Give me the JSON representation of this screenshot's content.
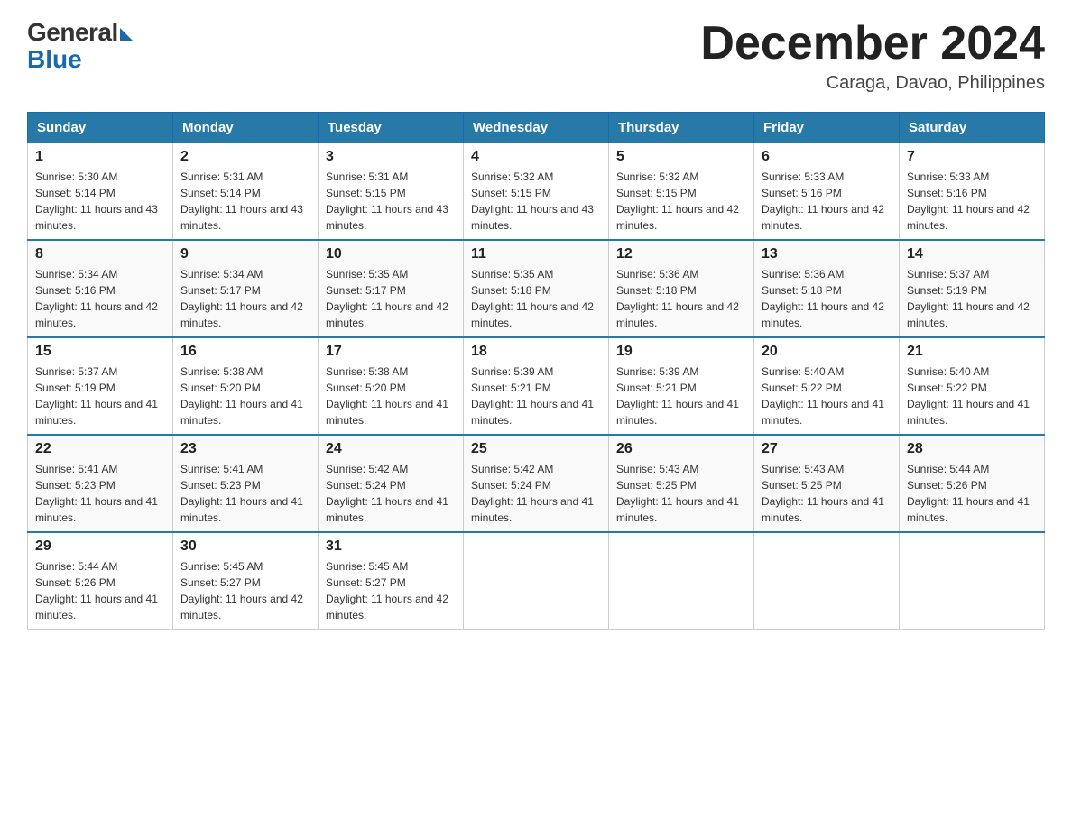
{
  "logo": {
    "general": "General",
    "blue": "Blue"
  },
  "title": {
    "month_year": "December 2024",
    "location": "Caraga, Davao, Philippines"
  },
  "weekdays": [
    "Sunday",
    "Monday",
    "Tuesday",
    "Wednesday",
    "Thursday",
    "Friday",
    "Saturday"
  ],
  "weeks": [
    [
      {
        "day": "1",
        "sunrise": "5:30 AM",
        "sunset": "5:14 PM",
        "daylight": "11 hours and 43 minutes."
      },
      {
        "day": "2",
        "sunrise": "5:31 AM",
        "sunset": "5:14 PM",
        "daylight": "11 hours and 43 minutes."
      },
      {
        "day": "3",
        "sunrise": "5:31 AM",
        "sunset": "5:15 PM",
        "daylight": "11 hours and 43 minutes."
      },
      {
        "day": "4",
        "sunrise": "5:32 AM",
        "sunset": "5:15 PM",
        "daylight": "11 hours and 43 minutes."
      },
      {
        "day": "5",
        "sunrise": "5:32 AM",
        "sunset": "5:15 PM",
        "daylight": "11 hours and 42 minutes."
      },
      {
        "day": "6",
        "sunrise": "5:33 AM",
        "sunset": "5:16 PM",
        "daylight": "11 hours and 42 minutes."
      },
      {
        "day": "7",
        "sunrise": "5:33 AM",
        "sunset": "5:16 PM",
        "daylight": "11 hours and 42 minutes."
      }
    ],
    [
      {
        "day": "8",
        "sunrise": "5:34 AM",
        "sunset": "5:16 PM",
        "daylight": "11 hours and 42 minutes."
      },
      {
        "day": "9",
        "sunrise": "5:34 AM",
        "sunset": "5:17 PM",
        "daylight": "11 hours and 42 minutes."
      },
      {
        "day": "10",
        "sunrise": "5:35 AM",
        "sunset": "5:17 PM",
        "daylight": "11 hours and 42 minutes."
      },
      {
        "day": "11",
        "sunrise": "5:35 AM",
        "sunset": "5:18 PM",
        "daylight": "11 hours and 42 minutes."
      },
      {
        "day": "12",
        "sunrise": "5:36 AM",
        "sunset": "5:18 PM",
        "daylight": "11 hours and 42 minutes."
      },
      {
        "day": "13",
        "sunrise": "5:36 AM",
        "sunset": "5:18 PM",
        "daylight": "11 hours and 42 minutes."
      },
      {
        "day": "14",
        "sunrise": "5:37 AM",
        "sunset": "5:19 PM",
        "daylight": "11 hours and 42 minutes."
      }
    ],
    [
      {
        "day": "15",
        "sunrise": "5:37 AM",
        "sunset": "5:19 PM",
        "daylight": "11 hours and 41 minutes."
      },
      {
        "day": "16",
        "sunrise": "5:38 AM",
        "sunset": "5:20 PM",
        "daylight": "11 hours and 41 minutes."
      },
      {
        "day": "17",
        "sunrise": "5:38 AM",
        "sunset": "5:20 PM",
        "daylight": "11 hours and 41 minutes."
      },
      {
        "day": "18",
        "sunrise": "5:39 AM",
        "sunset": "5:21 PM",
        "daylight": "11 hours and 41 minutes."
      },
      {
        "day": "19",
        "sunrise": "5:39 AM",
        "sunset": "5:21 PM",
        "daylight": "11 hours and 41 minutes."
      },
      {
        "day": "20",
        "sunrise": "5:40 AM",
        "sunset": "5:22 PM",
        "daylight": "11 hours and 41 minutes."
      },
      {
        "day": "21",
        "sunrise": "5:40 AM",
        "sunset": "5:22 PM",
        "daylight": "11 hours and 41 minutes."
      }
    ],
    [
      {
        "day": "22",
        "sunrise": "5:41 AM",
        "sunset": "5:23 PM",
        "daylight": "11 hours and 41 minutes."
      },
      {
        "day": "23",
        "sunrise": "5:41 AM",
        "sunset": "5:23 PM",
        "daylight": "11 hours and 41 minutes."
      },
      {
        "day": "24",
        "sunrise": "5:42 AM",
        "sunset": "5:24 PM",
        "daylight": "11 hours and 41 minutes."
      },
      {
        "day": "25",
        "sunrise": "5:42 AM",
        "sunset": "5:24 PM",
        "daylight": "11 hours and 41 minutes."
      },
      {
        "day": "26",
        "sunrise": "5:43 AM",
        "sunset": "5:25 PM",
        "daylight": "11 hours and 41 minutes."
      },
      {
        "day": "27",
        "sunrise": "5:43 AM",
        "sunset": "5:25 PM",
        "daylight": "11 hours and 41 minutes."
      },
      {
        "day": "28",
        "sunrise": "5:44 AM",
        "sunset": "5:26 PM",
        "daylight": "11 hours and 41 minutes."
      }
    ],
    [
      {
        "day": "29",
        "sunrise": "5:44 AM",
        "sunset": "5:26 PM",
        "daylight": "11 hours and 41 minutes."
      },
      {
        "day": "30",
        "sunrise": "5:45 AM",
        "sunset": "5:27 PM",
        "daylight": "11 hours and 42 minutes."
      },
      {
        "day": "31",
        "sunrise": "5:45 AM",
        "sunset": "5:27 PM",
        "daylight": "11 hours and 42 minutes."
      },
      null,
      null,
      null,
      null
    ]
  ],
  "labels": {
    "sunrise": "Sunrise:",
    "sunset": "Sunset:",
    "daylight": "Daylight:"
  }
}
